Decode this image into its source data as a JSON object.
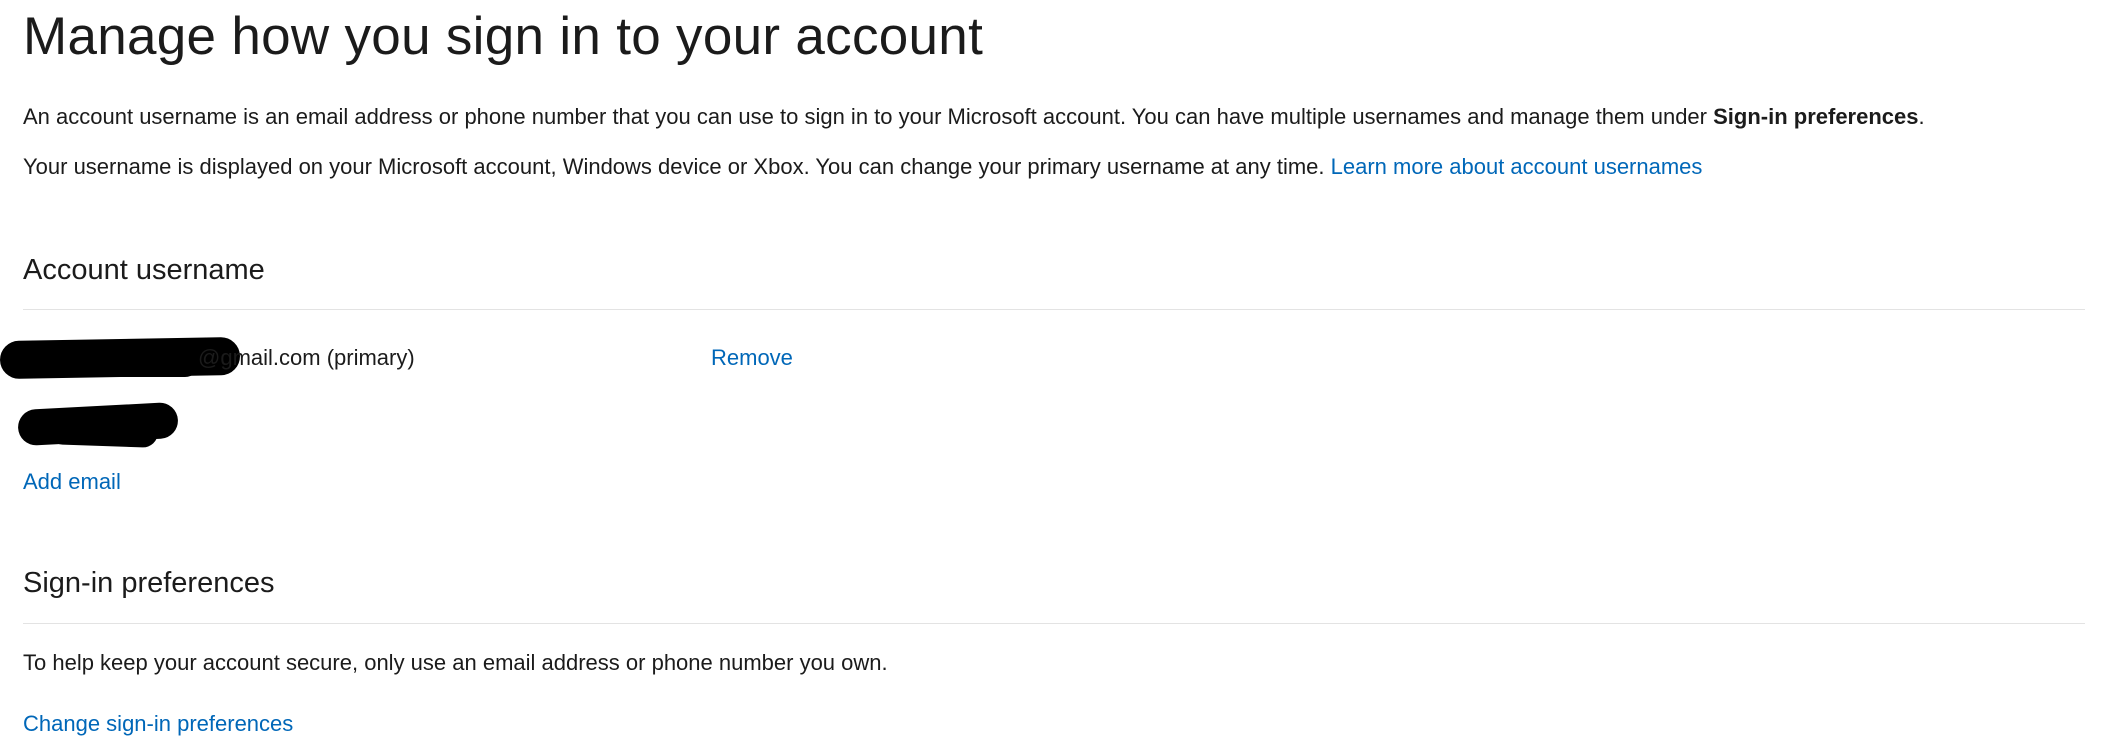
{
  "page": {
    "title": "Manage how you sign in to your account"
  },
  "intro": {
    "line1_text": "An account username is an email address or phone number that you can use to sign in to your Microsoft account. You can have multiple usernames and manage them under ",
    "line1_bold": "Sign-in preferences",
    "line1_end": ".",
    "line2_text": "Your username is displayed on your Microsoft account, Windows device or Xbox. You can change your primary username at any time. ",
    "line2_link": "Learn more about account usernames"
  },
  "account_username": {
    "heading": "Account username",
    "usernames": [
      {
        "visible_suffix": "@gmail.com (primary)",
        "action_label": "Remove",
        "redacted": true
      },
      {
        "visible_suffix": "",
        "redacted": true
      }
    ],
    "add_email_label": "Add email"
  },
  "signin_preferences": {
    "heading": "Sign-in preferences",
    "description": "To help keep your account secure, only use an email address or phone number you own.",
    "change_label": "Change sign-in preferences"
  },
  "colors": {
    "link": "#0067b8",
    "text": "#1b1b1b",
    "divider": "#e3e3e3",
    "redaction": "#000000"
  }
}
